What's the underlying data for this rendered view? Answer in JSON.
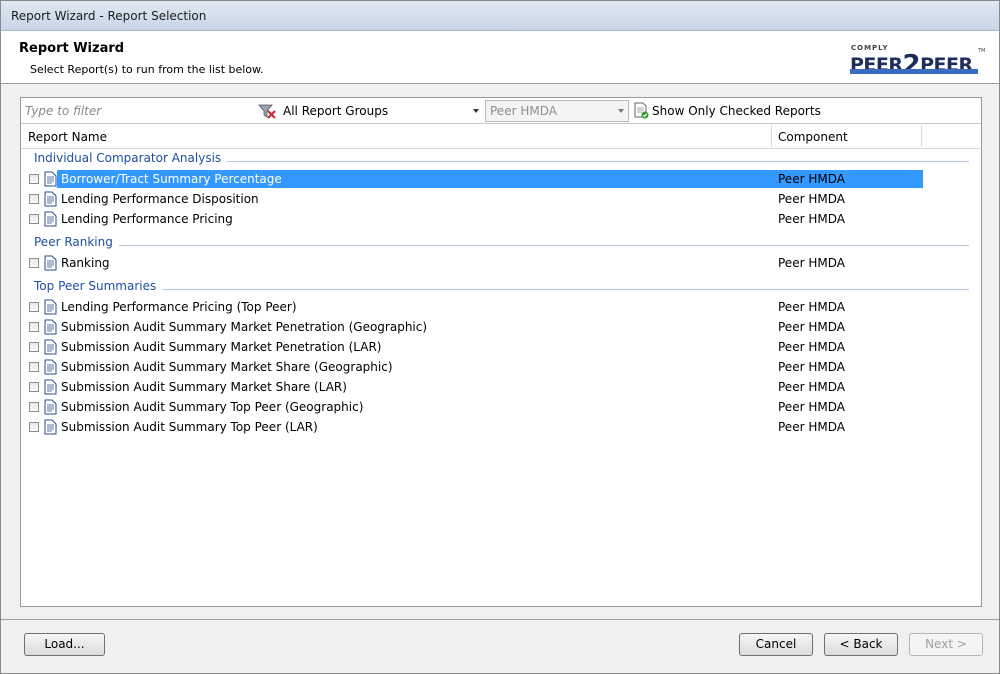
{
  "window": {
    "title": "Report Wizard - Report Selection"
  },
  "header": {
    "title": "Report Wizard",
    "subtitle": "Select Report(s) to run from the list below.",
    "logo": {
      "top_text": "COMPLY",
      "main_left": "PEER",
      "main_num": "2",
      "main_right": "PEER",
      "tm": "TM"
    }
  },
  "filter": {
    "placeholder": "Type to filter",
    "group_selected": "All Report Groups",
    "component_selected": "Peer HMDA",
    "show_checked_label": "Show Only Checked Reports"
  },
  "columns": {
    "name": "Report Name",
    "component": "Component"
  },
  "groups": [
    {
      "label": "Individual Comparator Analysis",
      "reports": [
        {
          "name": "Borrower/Tract Summary Percentage",
          "component": "Peer HMDA",
          "selected": true
        },
        {
          "name": "Lending Performance Disposition",
          "component": "Peer HMDA"
        },
        {
          "name": "Lending Performance Pricing",
          "component": "Peer HMDA"
        }
      ]
    },
    {
      "label": "Peer Ranking",
      "reports": [
        {
          "name": "Ranking",
          "component": "Peer HMDA"
        }
      ]
    },
    {
      "label": "Top Peer Summaries",
      "reports": [
        {
          "name": "Lending Performance Pricing (Top Peer)",
          "component": "Peer HMDA"
        },
        {
          "name": "Submission Audit Summary Market Penetration (Geographic)",
          "component": "Peer HMDA"
        },
        {
          "name": "Submission Audit Summary Market Penetration (LAR)",
          "component": "Peer HMDA"
        },
        {
          "name": "Submission Audit Summary Market Share (Geographic)",
          "component": "Peer HMDA"
        },
        {
          "name": "Submission Audit Summary Market Share (LAR)",
          "component": "Peer HMDA"
        },
        {
          "name": "Submission Audit Summary Top Peer (Geographic)",
          "component": "Peer HMDA"
        },
        {
          "name": "Submission Audit Summary Top Peer (LAR)",
          "component": "Peer HMDA"
        }
      ]
    }
  ],
  "buttons": {
    "load": "Load...",
    "cancel": "Cancel",
    "back": "< Back",
    "next": "Next >"
  },
  "colors": {
    "selection": "#3399ff",
    "group_label": "#1f4fa3"
  }
}
